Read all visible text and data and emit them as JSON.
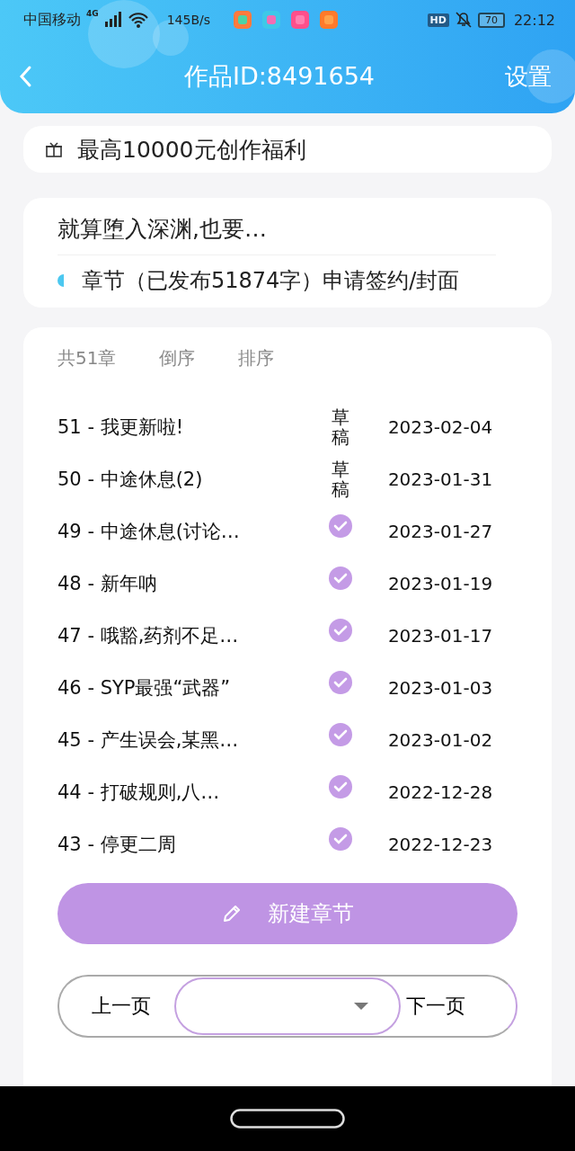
{
  "status_bar": {
    "carrier": "中国移动",
    "network": "4G",
    "speed": "145B/s",
    "hd": "HD",
    "battery": "70",
    "time": "22:12"
  },
  "header": {
    "title": "作品ID:8491654",
    "action": "设置"
  },
  "promo": {
    "text": "最高10000元创作福利"
  },
  "work": {
    "title": "就算堕入深渊,也要…",
    "chapters_link": "章节（已发布51874字）",
    "sign_link": "申请签约",
    "separator": "/",
    "cover_link": "封面"
  },
  "chapter_list": {
    "count": "共51章",
    "controls": [
      "倒序",
      "排序"
    ],
    "rows": [
      {
        "title": "51 - 我更新啦!",
        "kind": "draft",
        "status_text": "草稿",
        "date": "2023-02-04"
      },
      {
        "title": "50 - 中途休息(2)",
        "kind": "draft",
        "status_text": "草稿",
        "date": "2023-01-31"
      },
      {
        "title": "49 - 中途休息(讨论…",
        "kind": "published",
        "date": "2023-01-27"
      },
      {
        "title": "48 - 新年呐",
        "kind": "published",
        "date": "2023-01-19"
      },
      {
        "title": "47 - 哦豁,药剂不足…",
        "kind": "published",
        "date": "2023-01-17"
      },
      {
        "title": "46 - SYP最强“武器”",
        "kind": "published",
        "date": "2023-01-03"
      },
      {
        "title": "45 - 产生误会,某黑…",
        "kind": "published",
        "date": "2023-01-02"
      },
      {
        "title": "44 - 打破规则,八…",
        "kind": "published",
        "date": "2022-12-28"
      },
      {
        "title": "43 - 停更二周",
        "kind": "published",
        "date": "2022-12-23"
      }
    ],
    "new_button": "新建章节"
  },
  "pager": {
    "prev": "上一页",
    "next": "下一页"
  }
}
